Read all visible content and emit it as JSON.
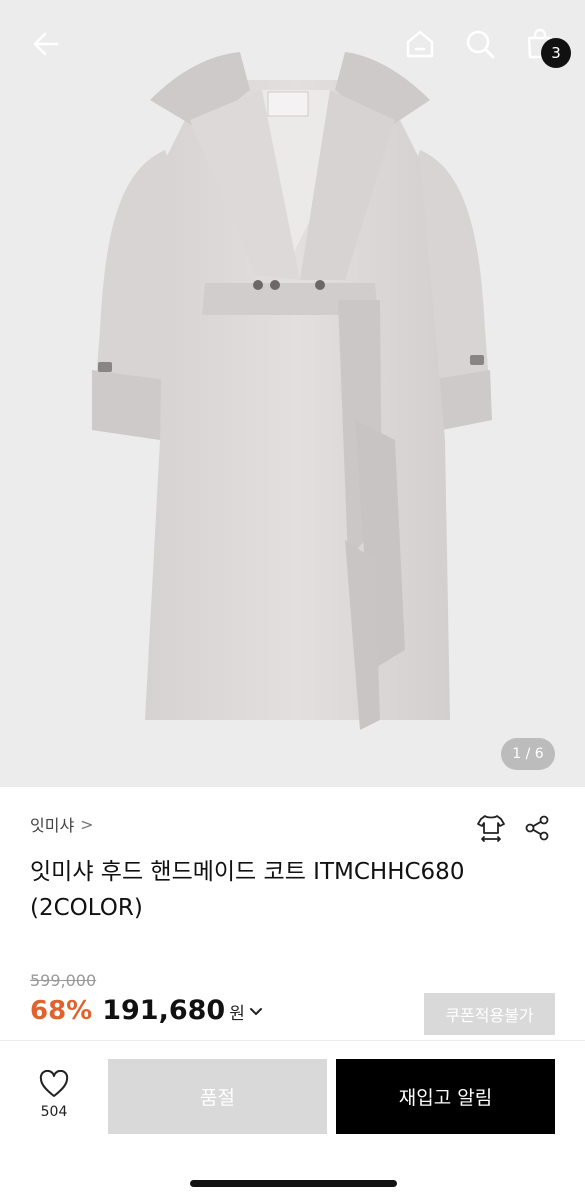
{
  "header": {
    "back_icon": "arrow-left-icon",
    "home_icon": "home-icon",
    "search_icon": "search-icon",
    "cart_icon": "shopping-bag-icon",
    "cart_count": "3"
  },
  "gallery": {
    "image_pager": "1 / 6"
  },
  "product": {
    "brand": "잇미샤",
    "brand_chevron": ">",
    "title": "잇미샤 후드 핸드메이드 코트 ITMCHHC680 (2COLOR)",
    "original_price": "599,000",
    "discount_rate": "68%",
    "sale_price": "191,680",
    "currency": "원",
    "coupon_label": "쿠폰적용불가",
    "size_icon": "size-guide-shirt-icon",
    "share_icon": "share-icon"
  },
  "bottom_bar": {
    "like_icon": "heart-icon",
    "like_count": "504",
    "soldout_label": "품절",
    "restock_label": "재입고 알림"
  },
  "colors": {
    "accent_discount": "#e0622e",
    "primary_button": "#000000",
    "disabled_button": "#d9d9d9",
    "hero_background": "#ececec"
  }
}
